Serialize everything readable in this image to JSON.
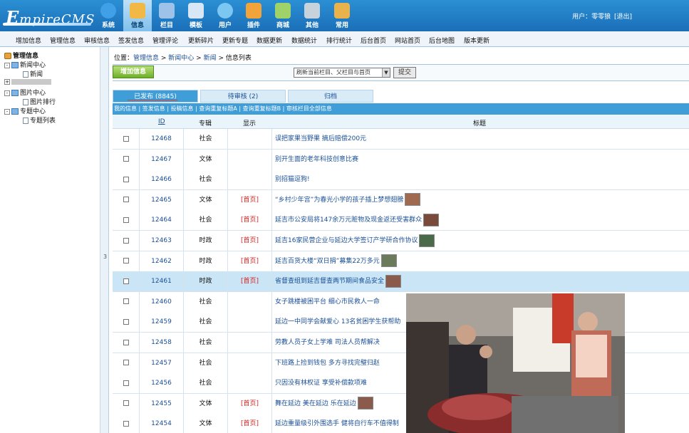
{
  "logo": {
    "first": "E",
    "rest": "mpireCMS"
  },
  "nav": [
    {
      "label": "系统",
      "icon": "globe-icon",
      "color": "#3fa0e8"
    },
    {
      "label": "信息",
      "icon": "pencil-notepad-icon",
      "color": "#f1b845"
    },
    {
      "label": "栏目",
      "icon": "folder-icon",
      "color": "#9fc3e8"
    },
    {
      "label": "模板",
      "icon": "window-template-icon",
      "color": "#d7e7f6"
    },
    {
      "label": "用户",
      "icon": "user-icon",
      "color": "#7cc6f2"
    },
    {
      "label": "插件",
      "icon": "tools-icon",
      "color": "#f2a33a"
    },
    {
      "label": "商城",
      "icon": "shop-icon",
      "color": "#9fd36a"
    },
    {
      "label": "其他",
      "icon": "gear-icon",
      "color": "#c7d2dc"
    },
    {
      "label": "常用",
      "icon": "box-icon",
      "color": "#e9b24a"
    }
  ],
  "user": {
    "label": "用户：",
    "name": "零零狼",
    "logout": "[退出]"
  },
  "submenu": [
    "增加信息",
    "管理信息",
    "审核信息",
    "签发信息",
    "管理评论",
    "更新碎片",
    "更新专题",
    "数据更新",
    "数据统计",
    "排行统计",
    "后台首页",
    "网站首页",
    "后台地图",
    "版本更新"
  ],
  "tree": {
    "root": "管理信息",
    "n1": "新闻中心",
    "n1a": "新闻",
    "n3": "图片中心",
    "n3a": "图片排行",
    "n4": "专题中心",
    "n4a": "专题列表"
  },
  "splitter_label": "3",
  "breadcrumb": {
    "prefix": "位置：",
    "a": "管理信息",
    "b": "新闻中心",
    "c": "新闻",
    "d": "信息列表",
    "sep": " > "
  },
  "toolbar": {
    "add_label": "增加信息",
    "select_value": "刷新当前栏目、父栏目与首页",
    "submit_label": "提交"
  },
  "tabs": [
    {
      "label": "已发布 (8845)",
      "active": true
    },
    {
      "label": "待审核 (2)",
      "active": false
    },
    {
      "label": "归档",
      "active": false
    }
  ],
  "links": [
    "我的信息",
    "签发信息",
    "投稿信息",
    "查询重复标题A",
    "查询重复标题B",
    "审核栏目全部信息"
  ],
  "table": {
    "headers": {
      "id": "ID",
      "col": "专辑",
      "show": "显示",
      "title": "标题"
    },
    "rows": [
      {
        "id": "12468",
        "col": "社会",
        "show": "",
        "title": "误把家果当野果 摘后赔偿200元",
        "thumb": false
      },
      {
        "id": "12467",
        "col": "文体",
        "show": "",
        "title": "别开生面的老年科技创意比赛",
        "thumb": false
      },
      {
        "id": "12466",
        "col": "社会",
        "show": "",
        "title": "别招猫逗狗!",
        "thumb": false
      },
      {
        "id": "12465",
        "col": "文体",
        "show": "[首页]",
        "title": "“乡村少年宫”为春光小学的孩子插上梦想翅膀",
        "thumb": true
      },
      {
        "id": "12464",
        "col": "社会",
        "show": "[首页]",
        "title": "延吉市公安局将147余万元赃物及现金返还受害群众",
        "thumb": true
      },
      {
        "id": "12463",
        "col": "时政",
        "show": "[首页]",
        "title": "延吉16家民营企业与延边大学签订产学研合作协议",
        "thumb": true
      },
      {
        "id": "12462",
        "col": "时政",
        "show": "[首页]",
        "title": "延吉百货大楼“双日捐”募集22万多元",
        "thumb": true
      },
      {
        "id": "12461",
        "col": "时政",
        "show": "[首页]",
        "title": "省督查组到延吉督查两节期间食品安全",
        "thumb": true,
        "hl": true
      },
      {
        "id": "12460",
        "col": "社会",
        "show": "",
        "title": "女子跳楼被困平台 细心市民救人一命",
        "thumb": false
      },
      {
        "id": "12459",
        "col": "社会",
        "show": "",
        "title": "延边一中同学会献爱心 13名贫困学生获帮助",
        "thumb": false
      },
      {
        "id": "12458",
        "col": "社会",
        "show": "",
        "title": "劳教人员子女上学难 司法人员帮解决",
        "thumb": false
      },
      {
        "id": "12457",
        "col": "社会",
        "show": "",
        "title": "下班路上捡到钱包 多方寻找完璧归赵",
        "thumb": false
      },
      {
        "id": "12456",
        "col": "社会",
        "show": "",
        "title": "只因没有林权证 享受补偿款项难",
        "thumb": false
      },
      {
        "id": "12455",
        "col": "文体",
        "show": "[首页]",
        "title": "舞在延边 美在延边 乐在延边",
        "thumb": true
      },
      {
        "id": "12454",
        "col": "文体",
        "show": "[首页]",
        "title": "延边重量级引外围选手 健将自行车不值得制",
        "thumb": false
      }
    ]
  }
}
